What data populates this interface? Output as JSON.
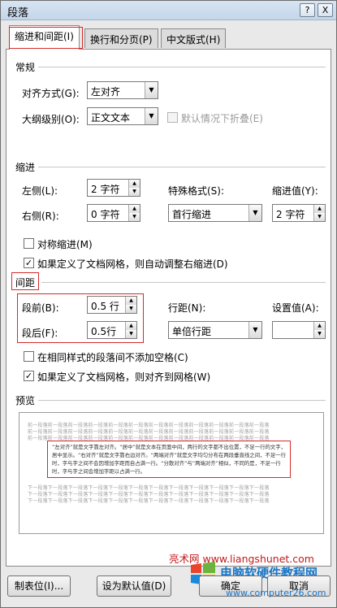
{
  "window": {
    "title": "段落",
    "help_label": "?",
    "close_label": "X"
  },
  "tabs": [
    {
      "label": "缩进和间距(I)",
      "active": true
    },
    {
      "label": "换行和分页(P)",
      "active": false
    },
    {
      "label": "中文版式(H)",
      "active": false
    }
  ],
  "general": {
    "section_label": "常规",
    "alignment_label": "对齐方式(G):",
    "alignment_value": "左对齐",
    "outline_label": "大纲级别(O):",
    "outline_value": "正文文本",
    "collapsed_label": "默认情况下折叠(E)"
  },
  "indent": {
    "section_label": "缩进",
    "left_label": "左侧(L):",
    "left_value": "2 字符",
    "right_label": "右侧(R):",
    "right_value": "0 字符",
    "special_label": "特殊格式(S):",
    "special_value": "首行缩进",
    "by_label": "缩进值(Y):",
    "by_value": "2 字符",
    "mirror_label": "对称缩进(M)",
    "mirror_checked": false,
    "auto_adjust_label": "如果定义了文档网格，则自动调整右缩进(D)",
    "auto_adjust_checked": true
  },
  "spacing": {
    "section_label": "间距",
    "before_label": "段前(B):",
    "before_value": "0.5 行",
    "after_label": "段后(F):",
    "after_value": "0.5行",
    "line_label": "行距(N):",
    "line_value": "单倍行距",
    "at_label": "设置值(A):",
    "at_value": "",
    "no_space_label": "在相同样式的段落间不添加空格(C)",
    "no_space_checked": false,
    "snap_grid_label": "如果定义了文档网格，则对齐到网格(W)",
    "snap_grid_checked": true
  },
  "preview": {
    "section_label": "预览",
    "prev_text": "前一段落前一段落前一段落前一段落前一段落前一段落前一段落前一段落前一段落前一段落前一段落前一段落",
    "sample_text": "“左对齐”就是文字靠左对齐。“居中”就是文本在页面中间，两行的文字都不出位置，不足一行的文字，居中显示。“右对齐”就是文字靠右边对齐。“两端对齐”就是文字均匀分布在两段垂直线之间，不足一行时，字与字之间不会因增加字距而自占满一行。“分散对齐”与“两端对齐”相似，不同的是，不足一行时，字与字之间会增加字距以占满一行。",
    "next_text": "下一段落下一段落下一段落下一段落下一段落下一段落下一段落下一段落下一段落下一段落下一段落下一段落"
  },
  "buttons": {
    "tabs_label": "制表位(I)...",
    "default_label": "设为默认值(D)",
    "ok_label": "确定",
    "cancel_label": "取消"
  },
  "watermark": {
    "site": "亮术网 www.liangshunet.com",
    "brand": "电脑软硬件教程网",
    "url": "www.computer26.com"
  },
  "colors": {
    "highlight": "#d42a2a",
    "watermark_red": "#c6191b",
    "watermark_blue": "#1a76c8"
  }
}
